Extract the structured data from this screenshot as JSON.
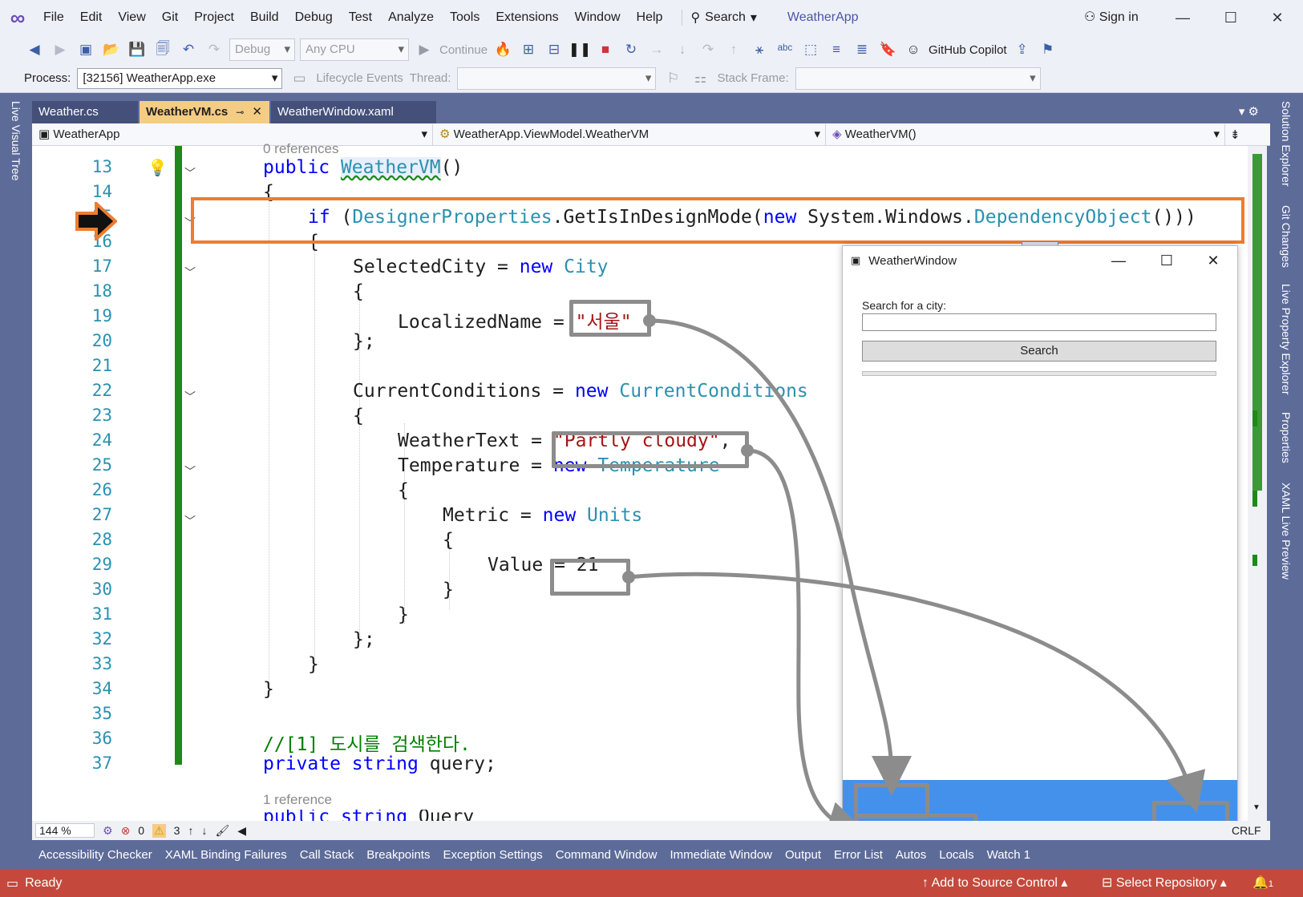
{
  "menu": {
    "items": [
      "File",
      "Edit",
      "View",
      "Git",
      "Project",
      "Build",
      "Debug",
      "Test",
      "Analyze",
      "Tools",
      "Extensions",
      "Window",
      "Help"
    ],
    "search_label": "Search",
    "app_title": "WeatherApp",
    "sign_in": "Sign in"
  },
  "toolbar": {
    "config": "Debug",
    "platform": "Any CPU",
    "continue_label": "Continue",
    "copilot_label": "GitHub Copilot",
    "process_label": "Process:",
    "process_value": "[32156] WeatherApp.exe",
    "lifecycle_label": "Lifecycle Events",
    "thread_label": "Thread:",
    "stack_frame_label": "Stack Frame:"
  },
  "side_tabs": {
    "left": [
      "Live Visual Tree"
    ],
    "right": [
      "Solution Explorer",
      "Git Changes",
      "Live Property Explorer",
      "Properties",
      "XAML Live Preview"
    ]
  },
  "doc_tabs": [
    {
      "label": "Weather.cs",
      "active": false
    },
    {
      "label": "WeatherVM.cs",
      "active": true
    },
    {
      "label": "WeatherWindow.xaml",
      "active": false
    }
  ],
  "navbar": {
    "project": "WeatherApp",
    "type": "WeatherApp.ViewModel.WeatherVM",
    "member": "WeatherVM()"
  },
  "editor": {
    "line_numbers": [
      "13",
      "14",
      "15",
      "16",
      "17",
      "18",
      "19",
      "20",
      "21",
      "22",
      "23",
      "24",
      "25",
      "26",
      "27",
      "28",
      "29",
      "30",
      "31",
      "32",
      "33",
      "34",
      "35",
      "36",
      "37"
    ],
    "ref_hint_top": "0 references",
    "ref_hint_bottom": "1 reference",
    "code": {
      "l13_kw": "public",
      "l13_name": "WeatherVM",
      "l13_rest": "()",
      "l14": "{",
      "l15_kw": "if",
      "l15_p1": " (",
      "l15_t1": "DesignerProperties",
      "l15_p2": ".GetIsInDesignMode(",
      "l15_kw2": "new",
      "l15_p3": " System.Windows.",
      "l15_t2": "DependencyObject",
      "l15_p4": "()))",
      "l16": "{",
      "l17_a": "SelectedCity = ",
      "l17_kw": "new",
      "l17_t": "City",
      "l18": "{",
      "l19_a": "LocalizedName = ",
      "l19_str": "\"서울\"",
      "l20": "};",
      "l22_a": "CurrentConditions = ",
      "l22_kw": "new",
      "l22_t": "CurrentConditions",
      "l23": "{",
      "l24_a": "WeatherText = ",
      "l24_str": "\"Partly cloudy\"",
      "l24_b": ",",
      "l25_a": "Temperature = ",
      "l25_kw": "new",
      "l25_t": "Temperature",
      "l26": "{",
      "l27_a": "Metric = ",
      "l27_kw": "new",
      "l27_t": "Units",
      "l28": "{",
      "l29_a": "Value ",
      "l29_b": "= 21",
      "l30": "}",
      "l31": "}",
      "l32": "};",
      "l33": "}",
      "l34": "}",
      "l36": "//[1] 도시를 검색한다.",
      "l37_kw1": "private",
      "l37_kw2": "string",
      "l37_rest": "query;",
      "l38_kw1": "public",
      "l38_kw2": "string",
      "l38_rest": "Query"
    }
  },
  "preview": {
    "title": "WeatherWindow",
    "search_label": "Search for a city:",
    "button_label": "Search"
  },
  "editor_status": {
    "zoom": "144 %",
    "errors": "0",
    "warnings": "3"
  },
  "tool_tabs": [
    "Accessibility Checker",
    "XAML Binding Failures",
    "Call Stack",
    "Breakpoints",
    "Exception Settings",
    "Command Window",
    "Immediate Window",
    "Output",
    "Error List",
    "Autos",
    "Locals",
    "Watch 1"
  ],
  "statusbar": {
    "ready": "Ready",
    "add_source": "Add to Source Control",
    "select_repo": "Select Repository",
    "notifications": "1"
  },
  "colors": {
    "accent_orange": "#ed7d31",
    "status_red": "#c4493c",
    "chrome_blue": "#5d6b99",
    "preview_blue": "#4491ec"
  }
}
